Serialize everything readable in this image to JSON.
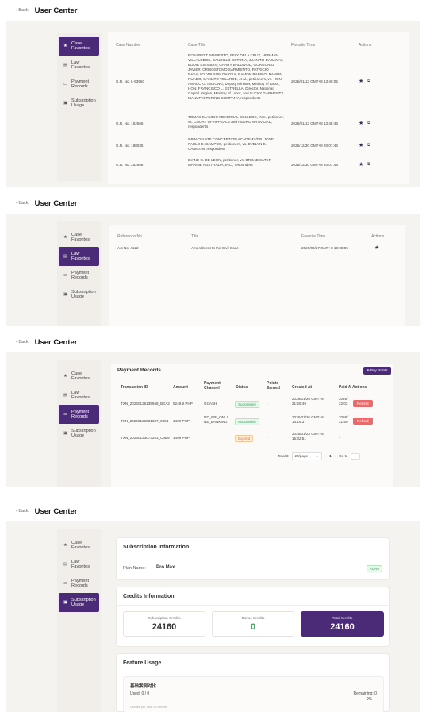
{
  "app": {
    "back_label": "Back",
    "title": "User Center"
  },
  "sidebar": {
    "items": [
      {
        "label_1": "Case",
        "label_2": "Favorites",
        "icon": "star-icon"
      },
      {
        "label_1": "Law",
        "label_2": "Favorites",
        "icon": "document-icon"
      },
      {
        "label_1": "Payment",
        "label_2": "Records",
        "icon": "card-icon"
      },
      {
        "label_1": "Subscription",
        "label_2": "Usage",
        "icon": "receipt-icon"
      }
    ]
  },
  "case_favorites": {
    "headers": {
      "number": "Case Number",
      "title": "Case Title",
      "time": "Favorite Time",
      "actions": "Actions"
    },
    "rows": [
      {
        "number": "G.R. No. L-53560",
        "title": "ROSARIO T. MAMERTO, FELY DELA CRUZ, HERMAN VILLALOBOS, BAUDILLO BOTONA, JUANITO DACANAY, EDDIE ESTEBAN, GARRY BALDIVOD, GORGONIO JAVIER, CRISOSTOMO SARMIENTO, PATRICIO BASALLO, WILSON GARCIA, RAMON RABINO, RAMON RUADO, CARLITO VELARDE, et al., petitioners, vs. HON. AMADO G. INCIONG, Deputy Minister, Ministry of Labor, HON. FRANCISCO L. ESTRELLA, Director, National Capital Region, Ministry of Labor, and LUCKY GARMENTS MANUFACTURING COMPANY, respondents",
        "time": "2026/01/13 GMT+8 13:49:05"
      },
      {
        "number": "G.R. No. 152566",
        "title": "TOMAS CLAUDIO MEMORIAL COLLEGE, INC., petitioner, vs. COURT OF APPEALS and PEDRO NATIVIDAD, respondents",
        "time": "2026/01/13 GMT+8 13:48:46"
      },
      {
        "number": "G.R. No. 188035",
        "title": "IMMACULATE CONCEPTION ACADEMY/DR. JOSE PAULO E. CAMPOS, petitioners, vs. EVELYN E. CAMILON, respondent",
        "time": "2025/12/30 GMT+8 20:07:46"
      },
      {
        "number": "G.R. No. 252988",
        "title": "DIANE G. DE LEON, petitioner, vs. BROADWATER MARINE AUSTRALIA, INC., respondent",
        "time": "2025/12/30 GMT+8 20:07:45"
      }
    ]
  },
  "law_favorites": {
    "headers": {
      "ref": "Reference No.",
      "title": "Title",
      "time": "Favorite Time",
      "actions": "Actions"
    },
    "rows": [
      {
        "ref": "Act No. 4122",
        "title": "Amendment to the Civil Code",
        "time": "2026/06/27 GMT+8 19:08:05"
      }
    ]
  },
  "payment_records": {
    "heading": "Payment Records",
    "buy_label": "Buy Points",
    "headers": {
      "txn": "Transaction ID",
      "amount": "Amount",
      "channel_1": "Payment",
      "channel_2": "Channel",
      "status": "Status",
      "points_1": "Points",
      "points_2": "Earned",
      "created": "Created At",
      "paid": "Paid A",
      "actions": "Actions"
    },
    "rows": [
      {
        "txn": "TXN_20260126135948_BEA2",
        "amount": "5249.9 PHP",
        "channel_1": "GCASH",
        "channel_2": "",
        "status": "Succeeded",
        "status_type": "success",
        "points": "-",
        "created_1": "2026/01/26 GMT+8",
        "created_2": "21:59:49",
        "paid_1": "2026/",
        "paid_2": "22:02",
        "action": "Refund"
      },
      {
        "txn": "TXN_20260126081637_0054",
        "amount": "1499 PHP",
        "channel_1": "DD_BPI_ONLI",
        "channel_2": "NE_BANKING",
        "status": "Succeeded",
        "status_type": "success",
        "points": "-",
        "created_1": "2026/01/26 GMT+8",
        "created_2": "14:16:37",
        "paid_1": "2026/",
        "paid_2": "21:50",
        "action": "Refund"
      },
      {
        "txn": "TXN_20260123073251_C4E9",
        "amount": "1499 PHP",
        "channel_1": "",
        "channel_2": "",
        "status": "Expired",
        "status_type": "expired",
        "points": "-",
        "created_1": "2026/01/23 GMT+8",
        "created_2": "15:32:51",
        "paid_1": "-",
        "paid_2": "",
        "action": ""
      }
    ],
    "pagination": {
      "total": "Total 3",
      "page_size": "20/page",
      "current_page": "1",
      "goto": "Go to"
    }
  },
  "subscription": {
    "info_title": "Subscription Information",
    "plan_label": "Plan Name:",
    "plan_name": "Pro Max",
    "status": "Active",
    "credits_title": "Credits Information",
    "credits": {
      "subscription_label": "Subscription Credits",
      "subscription_value": "24160",
      "bonus_label": "Bonus Credits",
      "bonus_value": "0",
      "total_label": "Total Credits",
      "total_value": "24160"
    },
    "feature_title": "Feature Usage",
    "feature": {
      "name": "基础案例对比",
      "used": "Used: 0 / 0",
      "remaining": "Remaining: 0",
      "percent": "0%",
      "note": "Credits per unit: 50 credits"
    }
  },
  "colors": {
    "accent": "#4b2a78",
    "success": "#3aa55a",
    "expired": "#e07b24",
    "danger": "#e86a6a",
    "bonus": "#3aa55a"
  }
}
